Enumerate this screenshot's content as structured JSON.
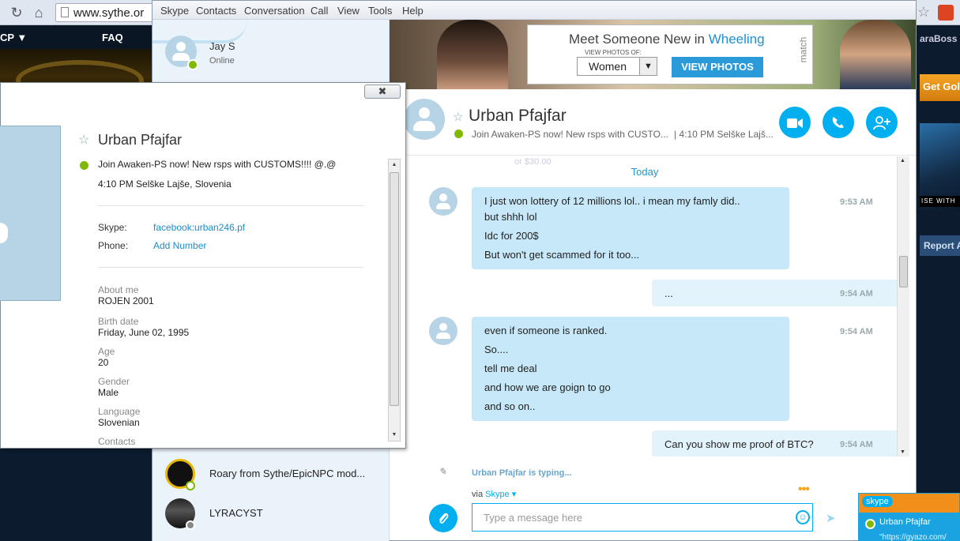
{
  "browser": {
    "url": "www.sythe.or",
    "site_nav": [
      "CP ▼",
      "FAQ"
    ],
    "right_user": "araBoss",
    "right_gold": "Get Gol",
    "right_ise": "ISE WITH",
    "right_report": "Report A"
  },
  "skype": {
    "menu": [
      "Skype",
      "Contacts",
      "Conversation",
      "Call",
      "View",
      "Tools",
      "Help"
    ],
    "me": {
      "name": "Jay S",
      "status": "Online"
    },
    "contacts": [
      {
        "name": "Roary from Sythe/EpicNPC mod..."
      },
      {
        "name": "LYRACYST"
      }
    ],
    "ad": {
      "title": "Meet Someone New in",
      "city": "Wheeling",
      "sub": "VIEW PHOTOS OF:",
      "select": "Women",
      "button": "VIEW PHOTOS",
      "brand": "match"
    },
    "conversation": {
      "name": "Urban Pfajfar",
      "mood": "Join Awaken-PS now! New rsps with CUSTO...",
      "location": "| 4:10 PM Selške Lajš...",
      "ghost_text": "or $30.00",
      "day": "Today",
      "messages": [
        {
          "from": "them",
          "lines": [
            "I just won lottery of 12 millions lol.. i mean my famly did..",
            "but shhh lol",
            "Idc for 200$",
            "But won't get scammed for it too..."
          ],
          "time": "9:53 AM"
        },
        {
          "from": "me",
          "lines": [
            "..."
          ],
          "time": "9:54 AM"
        },
        {
          "from": "them",
          "lines": [
            "even if someone is ranked.",
            "So....",
            "tell me deal",
            "and how we are goign to go",
            "and so on.."
          ],
          "time": "9:54 AM"
        },
        {
          "from": "me",
          "lines": [
            "Can you show me proof of BTC?"
          ],
          "time": "9:54 AM"
        }
      ],
      "typing": "Urban Pfajfar is typing...",
      "via_label": "via",
      "via_service": "Skype ▾",
      "input_placeholder": "Type a message here"
    }
  },
  "profile": {
    "name": "Urban Pfajfar",
    "mood": "Join Awaken-PS now! New rsps with CUSTOMS!!!! @.@",
    "local_time": "4:10 PM Selške Lajše, Slovenia",
    "skype_label": "Skype:",
    "skype_value": "facebook:urban246.pf",
    "phone_label": "Phone:",
    "phone_value": "Add Number",
    "fields": [
      {
        "key": "About me",
        "value": "ROJEN 2001"
      },
      {
        "key": "Birth date",
        "value": "Friday, June 02, 1995"
      },
      {
        "key": "Age",
        "value": "20"
      },
      {
        "key": "Gender",
        "value": "Male"
      },
      {
        "key": "Language",
        "value": "Slovenian"
      },
      {
        "key": "Contacts",
        "value": ""
      }
    ]
  },
  "notification": {
    "logo": "skype",
    "name": "Urban Pfajfar",
    "sub": "\"https://gyazo.com/"
  },
  "colors": {
    "skype_blue": "#00aff0",
    "online_green": "#7fba00",
    "bubble_in": "#c7e8f8",
    "bubble_out": "#e3f3fb"
  },
  "icons": {
    "back": "back-icon",
    "home": "home-icon",
    "video": "video-call-icon",
    "call": "call-icon",
    "add": "add-contact-icon",
    "attach": "attach-icon",
    "emoji": "emoji-icon",
    "send": "send-icon"
  }
}
